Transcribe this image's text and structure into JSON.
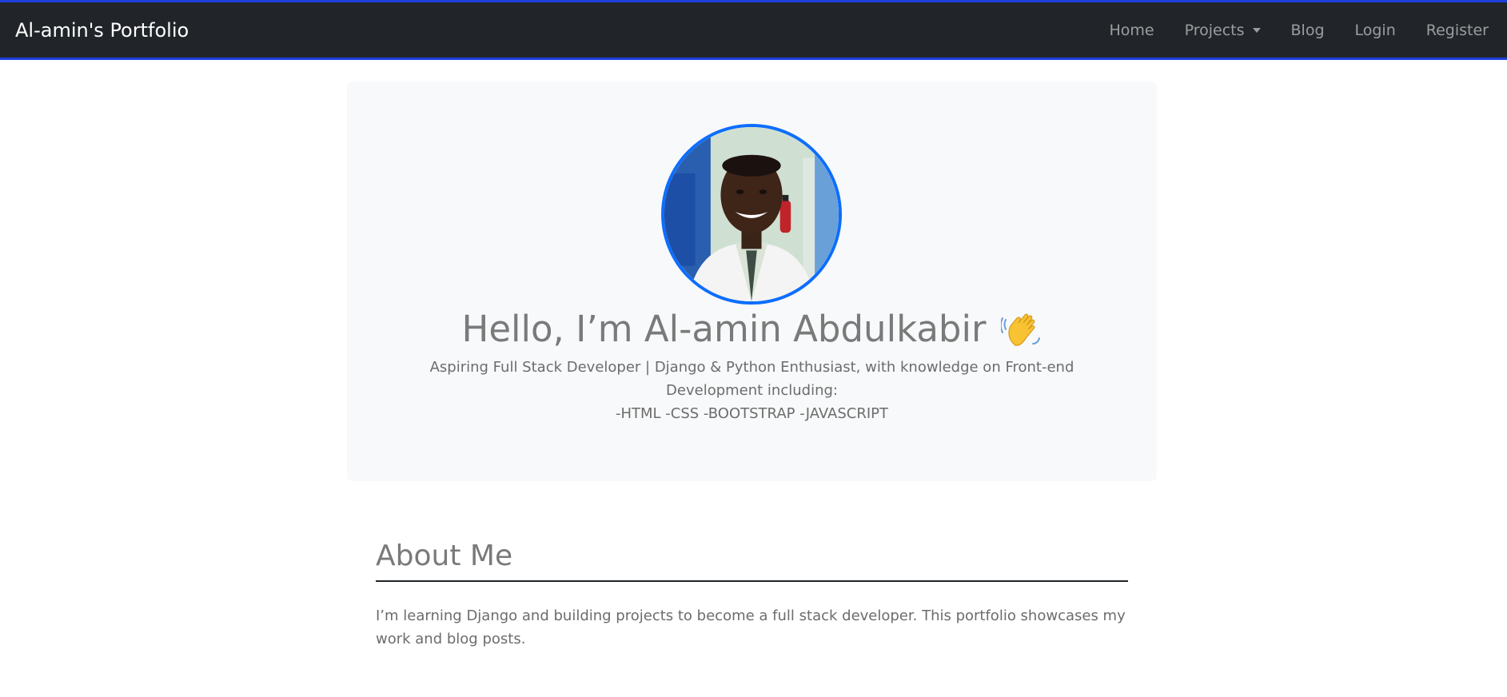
{
  "nav": {
    "brand": "Al-amin's Portfolio",
    "links": {
      "home": "Home",
      "projects": "Projects",
      "blog": "Blog",
      "login": "Login",
      "register": "Register"
    }
  },
  "hero": {
    "title": "Hello, I’m Al-amin Abdulkabir",
    "lead_line1": "Aspiring Full Stack Developer | Django & Python Enthusiast, with knowledge on Front-end Development including:",
    "lead_line2": "-HTML -CSS -BOOTSTRAP -JAVASCRIPT",
    "emoji": "waving-hand-icon"
  },
  "about": {
    "title": "About Me",
    "text": "I’m learning Django and building projects to become a full stack developer. This portfolio showcases my work and blog posts."
  },
  "colors": {
    "navbar_bg": "#212529",
    "navbar_border": "#1f3fdc",
    "avatar_ring": "#0d6efd",
    "hero_bg": "#f8f9fa"
  }
}
